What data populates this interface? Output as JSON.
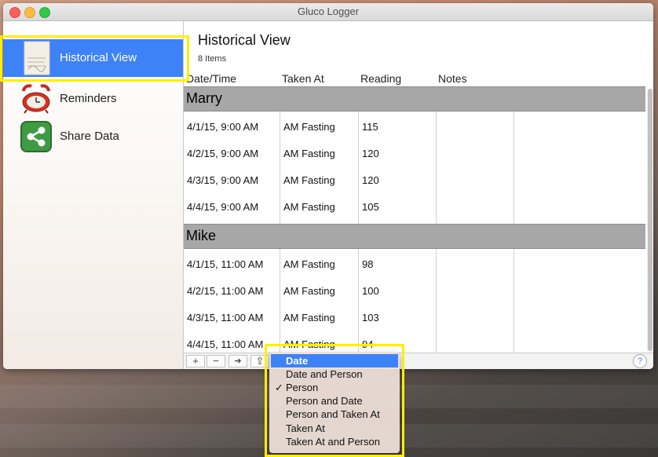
{
  "window": {
    "title": "Gluco Logger"
  },
  "sidebar": {
    "items": [
      {
        "label": "Historical View",
        "icon": "notebook-icon",
        "selected": true
      },
      {
        "label": "Reminders",
        "icon": "alarm-clock-icon",
        "selected": false
      },
      {
        "label": "Share Data",
        "icon": "share-icon",
        "selected": false
      }
    ]
  },
  "main": {
    "title": "Historical View",
    "item_count": "8 Items",
    "columns": [
      "Date/Time",
      "Taken At",
      "Reading",
      "Notes"
    ],
    "groups": [
      {
        "name": "Marry",
        "rows": [
          {
            "datetime": "4/1/15, 9:00 AM",
            "taken_at": "AM Fasting",
            "reading": "115",
            "notes": ""
          },
          {
            "datetime": "4/2/15, 9:00 AM",
            "taken_at": "AM Fasting",
            "reading": "120",
            "notes": ""
          },
          {
            "datetime": "4/3/15, 9:00 AM",
            "taken_at": "AM Fasting",
            "reading": "120",
            "notes": ""
          },
          {
            "datetime": "4/4/15, 9:00 AM",
            "taken_at": "AM Fasting",
            "reading": "105",
            "notes": ""
          }
        ]
      },
      {
        "name": "Mike",
        "rows": [
          {
            "datetime": "4/1/15, 11:00 AM",
            "taken_at": "AM Fasting",
            "reading": "98",
            "notes": ""
          },
          {
            "datetime": "4/2/15, 11:00 AM",
            "taken_at": "AM Fasting",
            "reading": "100",
            "notes": ""
          },
          {
            "datetime": "4/3/15, 11:00 AM",
            "taken_at": "AM Fasting",
            "reading": "103",
            "notes": ""
          },
          {
            "datetime": "4/4/15, 11:00 AM",
            "taken_at": "AM Fasting",
            "reading": "94",
            "notes": ""
          }
        ]
      }
    ]
  },
  "toolbar": {
    "add": "+",
    "remove": "−",
    "go": "➜",
    "share": "⇪",
    "help": "?"
  },
  "sort_menu": {
    "items": [
      {
        "label": "Date",
        "highlighted": true,
        "checked": false
      },
      {
        "label": "Date and Person",
        "highlighted": false,
        "checked": false
      },
      {
        "label": "Person",
        "highlighted": false,
        "checked": true
      },
      {
        "label": "Person and Date",
        "highlighted": false,
        "checked": false
      },
      {
        "label": "Person and Taken At",
        "highlighted": false,
        "checked": false
      },
      {
        "label": "Taken At",
        "highlighted": false,
        "checked": false
      },
      {
        "label": "Taken At and Person",
        "highlighted": false,
        "checked": false
      }
    ],
    "check_mark": "✓"
  },
  "colors": {
    "selection": "#3d82f7",
    "highlight_box": "#ffee00",
    "group_header": "#a7a7a7"
  }
}
